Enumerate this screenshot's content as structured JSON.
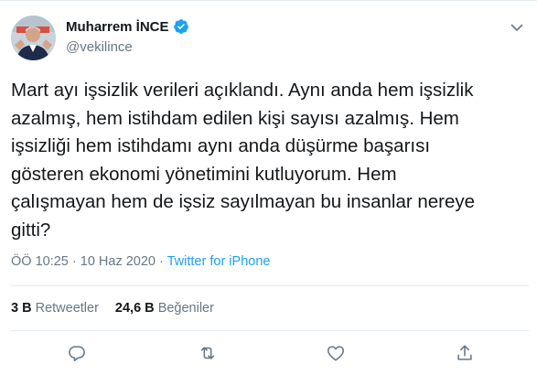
{
  "author": {
    "name": "Muharrem İNCE",
    "handle": "@vekilince",
    "verified": true,
    "avatar_icon": "profile-photo"
  },
  "tweet": {
    "lines": [
      "Mart ayı işsizlik verileri açıklandı. Aynı anda hem işsizlik",
      "azalmış, hem istihdam edilen kişi sayısı azalmış. Hem",
      "işsizliği hem istihdamı aynı anda düşürme başarısı",
      "gösteren ekonomi yönetimini kutluyorum. Hem",
      "çalışmayan hem de işsiz sayılmayan bu insanlar nereye",
      "gitti?"
    ]
  },
  "meta": {
    "time": "ÖÖ 10:25",
    "separator": " · ",
    "date": "10 Haz 2020",
    "separator2": " · ",
    "source": "Twitter for iPhone"
  },
  "stats": {
    "retweets_count": "3 B",
    "retweets_label": "Retweetler",
    "likes_count": "24,6 B",
    "likes_label": "Beğeniler"
  },
  "actions": [
    "reply-icon",
    "retweet-icon",
    "like-icon",
    "share-icon"
  ],
  "colors": {
    "text": "#14171a",
    "secondary": "#657786",
    "accent": "#1da1f2",
    "divider": "#e6ecf0"
  }
}
